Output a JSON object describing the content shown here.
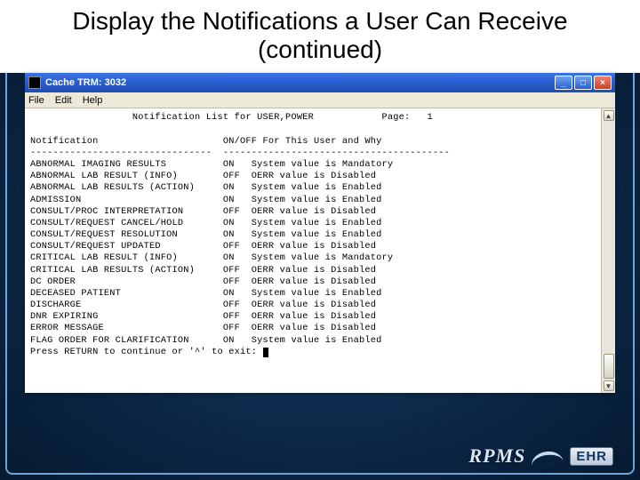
{
  "slide": {
    "title": "Display the Notifications a User Can Receive (continued)"
  },
  "window": {
    "title": "Cache TRM: 3032",
    "menus": [
      "File",
      "Edit",
      "Help"
    ]
  },
  "terminal": {
    "header_line": "Notification List for USER,POWER",
    "page_label": "Page:",
    "page_num": "1",
    "col1": "Notification",
    "col2": "ON/OFF For This User and Why",
    "rows": [
      {
        "name": "ABNORMAL IMAGING RESULTS",
        "state": "ON",
        "why": "System value is Mandatory"
      },
      {
        "name": "ABNORMAL LAB RESULT (INFO)",
        "state": "OFF",
        "why": "OERR value is Disabled"
      },
      {
        "name": "ABNORMAL LAB RESULTS (ACTION)",
        "state": "ON",
        "why": "System value is Enabled"
      },
      {
        "name": "ADMISSION",
        "state": "ON",
        "why": "System value is Enabled"
      },
      {
        "name": "CONSULT/PROC INTERPRETATION",
        "state": "OFF",
        "why": "OERR value is Disabled"
      },
      {
        "name": "CONSULT/REQUEST CANCEL/HOLD",
        "state": "ON",
        "why": "System value is Enabled"
      },
      {
        "name": "CONSULT/REQUEST RESOLUTION",
        "state": "ON",
        "why": "System value is Enabled"
      },
      {
        "name": "CONSULT/REQUEST UPDATED",
        "state": "OFF",
        "why": "OERR value is Disabled"
      },
      {
        "name": "CRITICAL LAB RESULT (INFO)",
        "state": "ON",
        "why": "System value is Mandatory"
      },
      {
        "name": "CRITICAL LAB RESULTS (ACTION)",
        "state": "OFF",
        "why": "OERR value is Disabled"
      },
      {
        "name": "DC ORDER",
        "state": "OFF",
        "why": "OERR value is Disabled"
      },
      {
        "name": "DECEASED PATIENT",
        "state": "ON",
        "why": "System value is Enabled"
      },
      {
        "name": "DISCHARGE",
        "state": "OFF",
        "why": "OERR value is Disabled"
      },
      {
        "name": "DNR EXPIRING",
        "state": "OFF",
        "why": "OERR value is Disabled"
      },
      {
        "name": "ERROR MESSAGE",
        "state": "OFF",
        "why": "OERR value is Disabled"
      },
      {
        "name": "FLAG ORDER FOR CLARIFICATION",
        "state": "ON",
        "why": "System value is Enabled"
      }
    ],
    "prompt": "Press RETURN to continue or '^' to exit: "
  },
  "footer": {
    "rpms": "RPMS",
    "ehr": "EHR"
  }
}
